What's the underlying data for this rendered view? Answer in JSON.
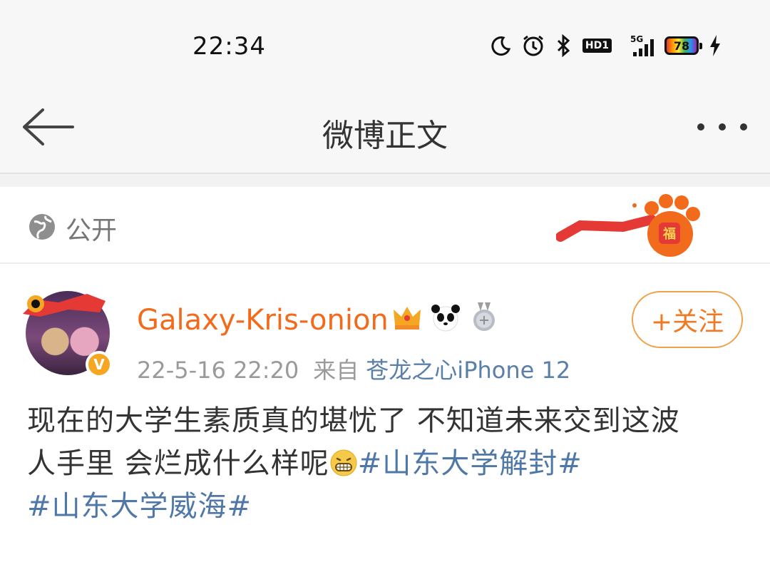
{
  "status_bar": {
    "time": "22:34",
    "icons": [
      "moon-icon",
      "alarm-icon",
      "bluetooth-icon",
      "hd-icon",
      "signal-5g-icon",
      "battery-icon",
      "charging-icon"
    ],
    "hd_label": "HD1",
    "network_label": "5G",
    "battery_percent": "78"
  },
  "nav": {
    "title": "微博正文",
    "back_icon": "arrow-left-icon",
    "more_icon": "more-dots-icon"
  },
  "visibility": {
    "label": "公开",
    "icon": "globe-icon"
  },
  "post": {
    "username": "Galaxy-Kris-onion",
    "time": "22-5-16 22:20",
    "source_prefix": "来自",
    "device": "苍龙之心iPhone 12",
    "follow_label": "+关注",
    "badges": [
      "crown-icon",
      "panda-icon",
      "medal-icon"
    ],
    "verified_mark": "V",
    "content_line1": "现在的大学生素质真的堪忧了 不知道未来交到这波",
    "content_line2_text": "人手里 会烂成什么样呢",
    "hashtag1": "#山东大学解封#",
    "hashtag2": "#山东大学威海#"
  },
  "colors": {
    "accent_orange": "#f26b1d",
    "link_blue": "#4f78a8",
    "nav_bg": "#f7f7f7"
  }
}
